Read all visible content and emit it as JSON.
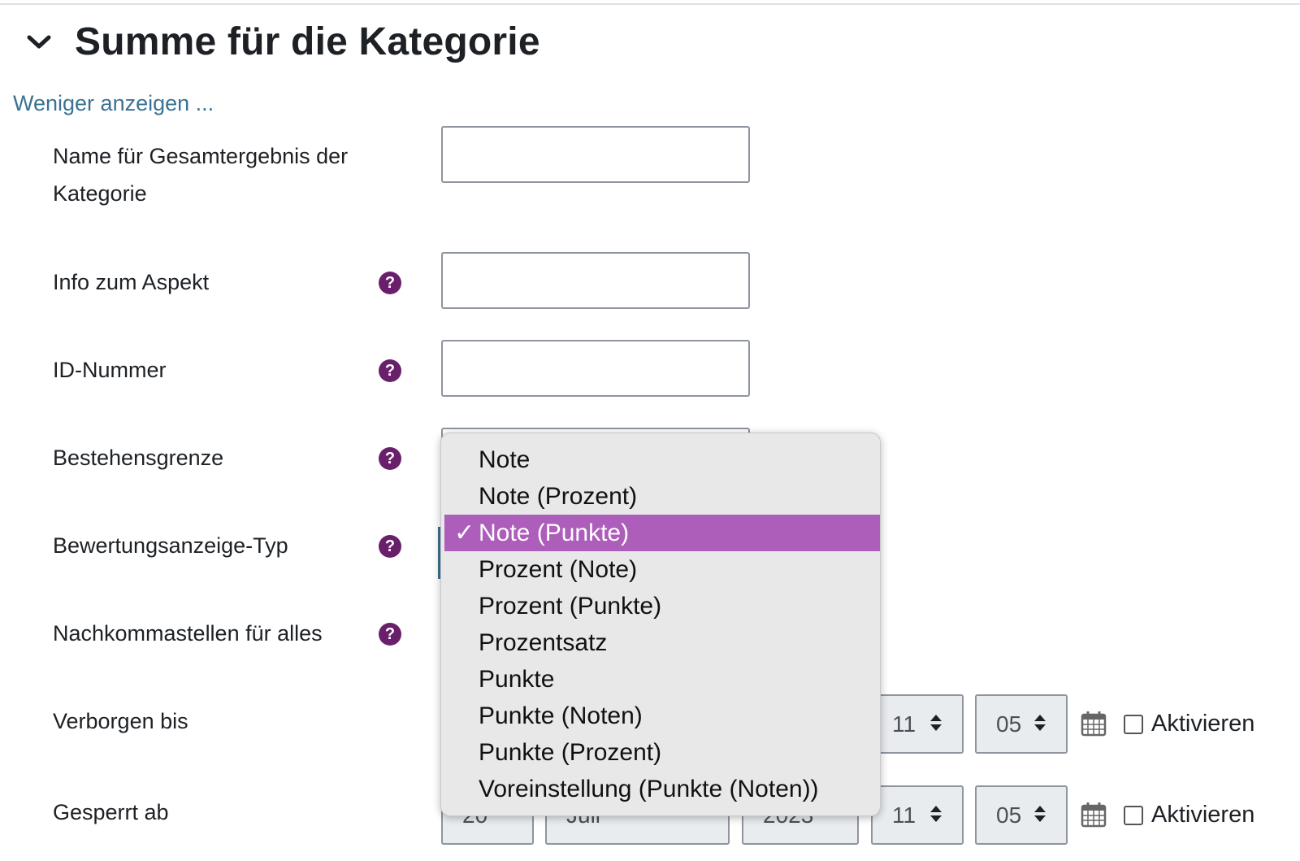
{
  "section": {
    "title": "Summe für die Kategorie",
    "toggle_link": "Weniger anzeigen ..."
  },
  "fields": {
    "name_label": "Name für Gesamtergebnis der Kategorie",
    "name_line1": "Name für Gesamtergebnis der",
    "name_line2": "Kategorie",
    "info_label": "Info zum Aspekt",
    "id_label": "ID-Nummer",
    "pass_label": "Bestehensgrenze",
    "display_type_label": "Bewertungsanzeige-Typ",
    "decimals_label": "Nachkommastellen für alles",
    "hidden_until_label": "Verborgen bis",
    "locked_after_label": "Gesperrt ab",
    "help_glyph": "?"
  },
  "hidden_until": {
    "hour": "11",
    "minute": "05",
    "enable_label": "Aktivieren",
    "enabled": false
  },
  "locked_after": {
    "day": "20",
    "month": "Juli",
    "year": "2023",
    "hour": "11",
    "minute": "05",
    "enable_label": "Aktivieren",
    "enabled": false
  },
  "dropdown": {
    "options": [
      "Note",
      "Note (Prozent)",
      "Note (Punkte)",
      "Prozent (Note)",
      "Prozent (Punkte)",
      "Prozentsatz",
      "Punkte",
      "Punkte (Noten)",
      "Punkte (Prozent)",
      "Voreinstellung (Punkte (Noten))"
    ],
    "selected_index": 2,
    "check_glyph": "✓",
    "highlight_color": "#ad5dba"
  },
  "icons": {
    "collapse": "chevron-down-icon",
    "help": "help-icon",
    "calendar": "calendar-icon",
    "select_arrows": "sort-arrows-icon"
  },
  "colors": {
    "link": "#3a7393",
    "help": "#6a1f6a",
    "selected_option": "#ad5dba"
  }
}
